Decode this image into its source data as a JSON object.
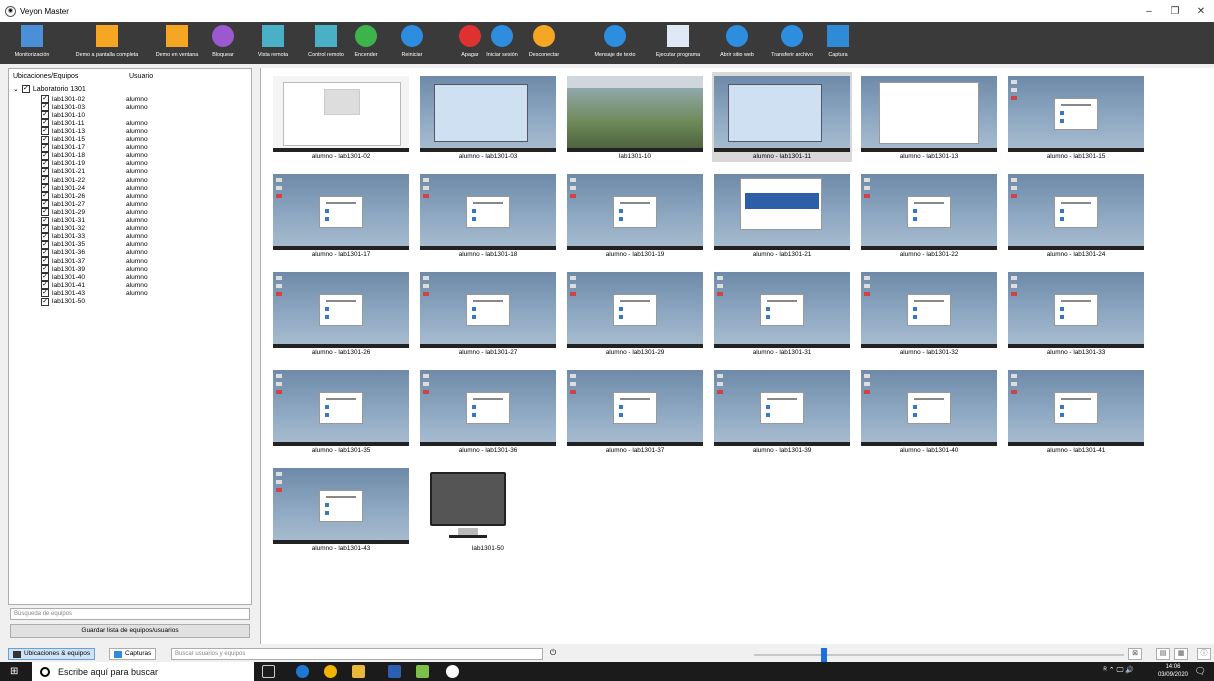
{
  "window": {
    "title": "Veyon Master",
    "minimize": "–",
    "maximize": "❐",
    "close": "✕"
  },
  "toolbar": [
    {
      "label": "Monitorización",
      "icon": "monitoring-icon",
      "color": "#4a90d9"
    },
    {
      "label": "Demo a pantalla completa",
      "icon": "fullscreen-demo-icon",
      "color": "#f5a623"
    },
    {
      "label": "Demo en ventana",
      "icon": "window-demo-icon",
      "color": "#f5a623"
    },
    {
      "label": "Bloquear",
      "icon": "lock-icon",
      "color": "#9b59d0"
    },
    {
      "label": "Vista remota",
      "icon": "remote-view-icon",
      "color": "#4ab0c6"
    },
    {
      "label": "Control remoto",
      "icon": "remote-control-icon",
      "color": "#4ab0c6"
    },
    {
      "label": "Encender",
      "icon": "power-on-icon",
      "color": "#3cb44b"
    },
    {
      "label": "Reiniciar",
      "icon": "reboot-icon",
      "color": "#2d8ee0"
    },
    {
      "label": "Apagar",
      "icon": "power-off-icon",
      "color": "#e03131"
    },
    {
      "label": "Iniciar sesión",
      "icon": "login-icon",
      "color": "#2d8ee0"
    },
    {
      "label": "Desconectar",
      "icon": "logout-icon",
      "color": "#f5a623"
    },
    {
      "label": "Mensaje de texto",
      "icon": "message-icon",
      "color": "#2d8ee0"
    },
    {
      "label": "Ejecutar programa",
      "icon": "run-program-icon",
      "color": "#dfe9f5"
    },
    {
      "label": "Abrir sitio web",
      "icon": "open-website-icon",
      "color": "#2d8ee0"
    },
    {
      "label": "Transferir archivo",
      "icon": "file-transfer-icon",
      "color": "#2d8ee0"
    },
    {
      "label": "Captura",
      "icon": "screenshot-icon",
      "color": "#2f8bd6"
    }
  ],
  "left": {
    "col_locations": "Ubicaciones/Equipos",
    "col_user": "Usuario",
    "root": "Laboratorio 1301",
    "computers": [
      {
        "name": "lab1301-02",
        "user": "alumno"
      },
      {
        "name": "lab1301-03",
        "user": "alumno"
      },
      {
        "name": "lab1301-10",
        "user": ""
      },
      {
        "name": "lab1301-11",
        "user": "alumno"
      },
      {
        "name": "lab1301-13",
        "user": "alumno"
      },
      {
        "name": "lab1301-15",
        "user": "alumno"
      },
      {
        "name": "lab1301-17",
        "user": "alumno"
      },
      {
        "name": "lab1301-18",
        "user": "alumno"
      },
      {
        "name": "lab1301-19",
        "user": "alumno"
      },
      {
        "name": "lab1301-21",
        "user": "alumno"
      },
      {
        "name": "lab1301-22",
        "user": "alumno"
      },
      {
        "name": "lab1301-24",
        "user": "alumno"
      },
      {
        "name": "lab1301-26",
        "user": "alumno"
      },
      {
        "name": "lab1301-27",
        "user": "alumno"
      },
      {
        "name": "lab1301-29",
        "user": "alumno"
      },
      {
        "name": "lab1301-31",
        "user": "alumno"
      },
      {
        "name": "lab1301-32",
        "user": "alumno"
      },
      {
        "name": "lab1301-33",
        "user": "alumno"
      },
      {
        "name": "lab1301-35",
        "user": "alumno"
      },
      {
        "name": "lab1301-36",
        "user": "alumno"
      },
      {
        "name": "lab1301-37",
        "user": "alumno"
      },
      {
        "name": "lab1301-39",
        "user": "alumno"
      },
      {
        "name": "lab1301-40",
        "user": "alumno"
      },
      {
        "name": "lab1301-41",
        "user": "alumno"
      },
      {
        "name": "lab1301-43",
        "user": "alumno"
      },
      {
        "name": "lab1301-50",
        "user": ""
      }
    ],
    "search_placeholder": "Búsqueda de equipos",
    "save_label": "Guardar lista de equipos/usuarios"
  },
  "tiles": [
    {
      "caption": "alumno - lab1301-02",
      "kind": "web"
    },
    {
      "caption": "alumno - lab1301-03",
      "kind": "blue"
    },
    {
      "caption": "lab1301-10",
      "kind": "photo"
    },
    {
      "caption": "alumno - lab1301-11",
      "kind": "blue",
      "selected": true
    },
    {
      "caption": "alumno - lab1301-13",
      "kind": "doc"
    },
    {
      "caption": "alumno - lab1301-15",
      "kind": "desk"
    },
    {
      "caption": "alumno - lab1301-17",
      "kind": "desk"
    },
    {
      "caption": "alumno - lab1301-18",
      "kind": "desk"
    },
    {
      "caption": "alumno - lab1301-19",
      "kind": "desk"
    },
    {
      "caption": "alumno - lab1301-21",
      "kind": "site"
    },
    {
      "caption": "alumno - lab1301-22",
      "kind": "desk"
    },
    {
      "caption": "alumno - lab1301-24",
      "kind": "desk"
    },
    {
      "caption": "alumno - lab1301-26",
      "kind": "desk"
    },
    {
      "caption": "alumno - lab1301-27",
      "kind": "desk"
    },
    {
      "caption": "alumno - lab1301-29",
      "kind": "desk"
    },
    {
      "caption": "alumno - lab1301-31",
      "kind": "desk"
    },
    {
      "caption": "alumno - lab1301-32",
      "kind": "desk"
    },
    {
      "caption": "alumno - lab1301-33",
      "kind": "desk"
    },
    {
      "caption": "alumno - lab1301-35",
      "kind": "desk"
    },
    {
      "caption": "alumno - lab1301-36",
      "kind": "desk"
    },
    {
      "caption": "alumno - lab1301-37",
      "kind": "desk"
    },
    {
      "caption": "alumno - lab1301-39",
      "kind": "desk"
    },
    {
      "caption": "alumno - lab1301-40",
      "kind": "desk"
    },
    {
      "caption": "alumno - lab1301-41",
      "kind": "desk"
    },
    {
      "caption": "alumno - lab1301-43",
      "kind": "desk"
    },
    {
      "caption": "lab1301-50",
      "kind": "offline"
    }
  ],
  "bottom": {
    "tab_locations": "Ubicaciones & equipos",
    "tab_captures": "Capturas",
    "search_placeholder": "Buscar usuarios y equipos",
    "zoom_fraction": 0.18
  },
  "taskbar": {
    "search_text": "Escribe aquí para buscar",
    "time": "14:06",
    "date": "03/09/2020"
  }
}
